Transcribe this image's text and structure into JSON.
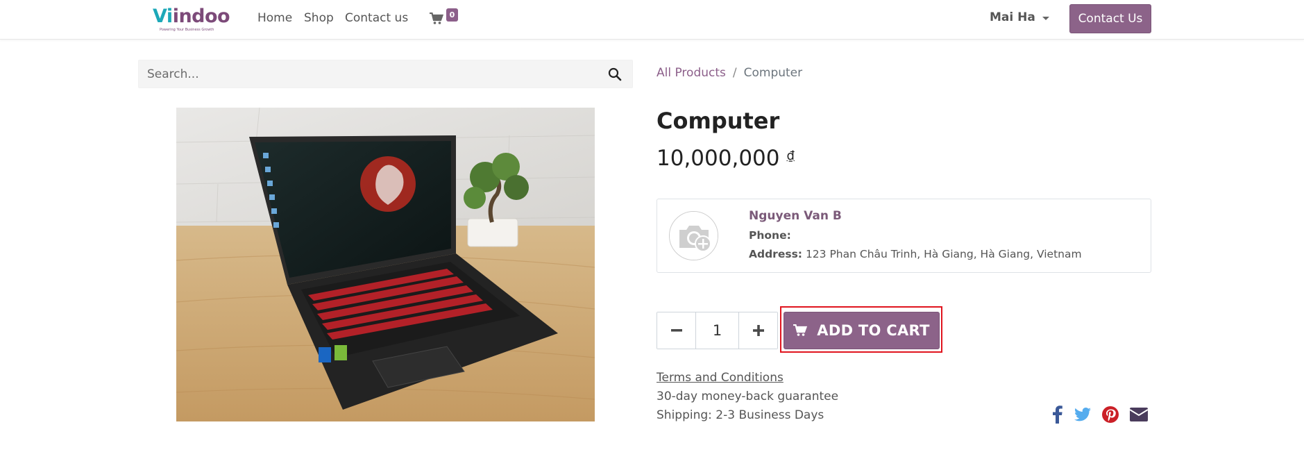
{
  "header": {
    "logo_text_vi": "Vi",
    "logo_text_rest": "indoo",
    "logo_tagline": "Powering Your Business Growth",
    "nav": [
      {
        "label": "Home"
      },
      {
        "label": "Shop"
      },
      {
        "label": "Contact us"
      }
    ],
    "cart_icon": "shopping-cart-icon",
    "cart_count": "0",
    "user_name": "Mai Ha",
    "contact_button": "Contact Us"
  },
  "search": {
    "placeholder": "Search...",
    "icon": "search-icon"
  },
  "breadcrumb": {
    "parent": "All Products",
    "separator": "/",
    "current": "Computer"
  },
  "product": {
    "title": "Computer",
    "price": "10,000,000",
    "currency": "₫",
    "image_icon": "laptop-photo"
  },
  "seller": {
    "avatar_icon": "camera-plus-icon",
    "name": "Nguyen Van B",
    "phone_label": "Phone:",
    "phone_value": "",
    "address_label": "Address:",
    "address_value": "123 Phan Châu Trinh, Hà Giang, Hà Giang, Vietnam"
  },
  "quantity": {
    "value": "1",
    "minus_icon": "minus-icon",
    "plus_icon": "plus-icon"
  },
  "add_to_cart": {
    "label": "ADD TO CART",
    "icon": "shopping-cart-icon"
  },
  "info": {
    "terms_link": "Terms and Conditions",
    "guarantee": "30-day money-back guarantee",
    "shipping": "Shipping: 2-3 Business Days"
  },
  "share": [
    {
      "icon": "facebook-icon",
      "color": "#3b5998"
    },
    {
      "icon": "twitter-icon",
      "color": "#55acee"
    },
    {
      "icon": "pinterest-icon",
      "color": "#cb2027"
    },
    {
      "icon": "email-icon",
      "color": "#4a3c5c"
    }
  ],
  "colors": {
    "brand": "#8c6389",
    "highlight": "#e0141e"
  }
}
